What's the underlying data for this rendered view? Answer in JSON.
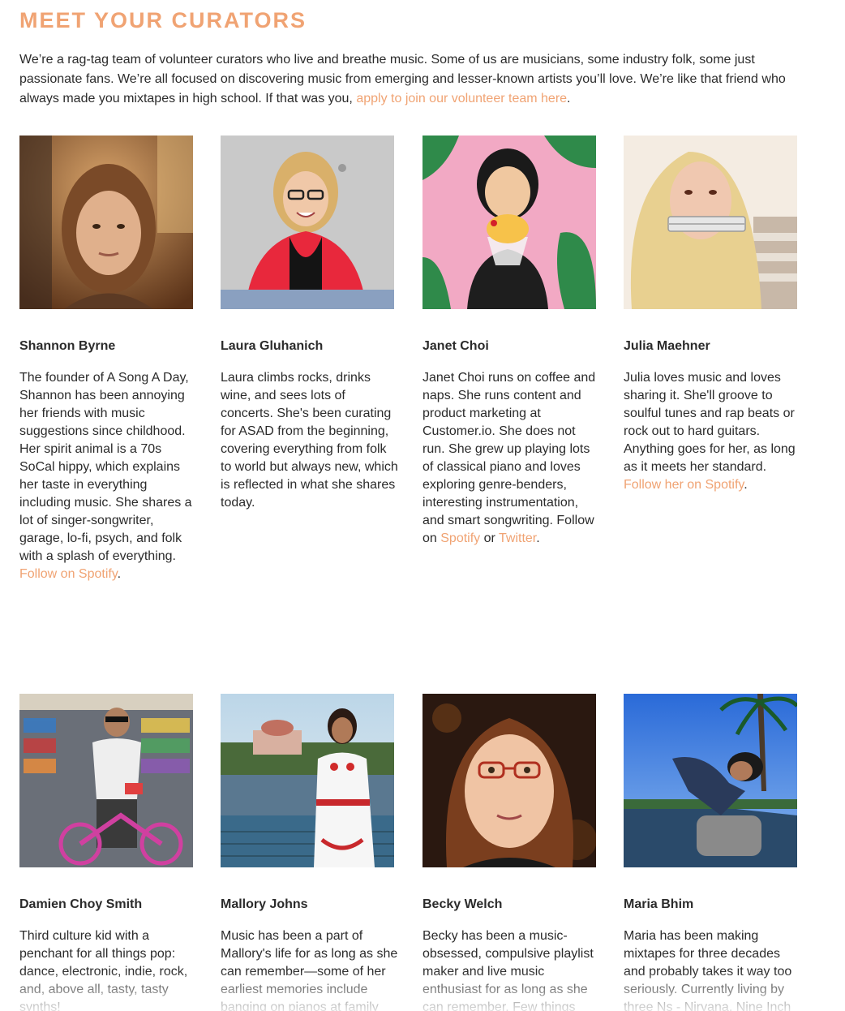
{
  "heading": "MEET YOUR CURATORS",
  "intro": {
    "text": "We’re a rag-tag team of volunteer curators who live and breathe music. Some of us are musicians, some industry folk, some just passionate fans. We’re all focused on discovering music from emerging and lesser-known artists you’ll love. We’re like that friend who always made you mixtapes in high school. If that was you, ",
    "link": "apply to join our volunteer team here",
    "tail": "."
  },
  "colors": {
    "accent": "#f0a373",
    "text": "#2b2b2b",
    "background": "#ffffff"
  },
  "curators": [
    {
      "name": "Shannon Byrne",
      "bio": "The founder of A Song A Day, Shannon has been annoying her friends with music suggestions since childhood. Her spirit animal is a 70s SoCal hippy, which explains her taste in everything including music. She shares a lot of singer-songwriter, garage, lo-fi, psych, and folk with a splash of everything. ",
      "link1": "Follow on Spotify",
      "tail": "."
    },
    {
      "name": "Laura Gluhanich",
      "bio": "Laura climbs rocks, drinks wine, and sees lots of concerts. She's been curating for ASAD from the beginning, covering everything from folk to world but always new, which is reflected in what she shares today."
    },
    {
      "name": "Janet Choi",
      "bio": "Janet Choi runs on coffee and naps. She runs content and product marketing at Customer.io. She does not run. She grew up playing lots of classical piano and loves exploring genre-benders, interesting instrumentation, and smart songwriting. Follow on ",
      "link1": "Spotify",
      "mid": " or ",
      "link2": "Twitter",
      "tail": "."
    },
    {
      "name": "Julia Maehner",
      "bio": "Julia loves music and loves sharing it. She'll groove to soulful tunes and rap beats or rock out to hard guitars. Anything goes for her, as long as it meets her standard. ",
      "link1": "Follow her on Spotify",
      "tail": "."
    },
    {
      "name": "Damien Choy Smith",
      "bio": "Third culture kid with a penchant for all things pop: dance, electronic, indie, rock, and, above all, tasty, tasty synths!"
    },
    {
      "name": "Mallory Johns",
      "bio": "Music has been a part of Mallory's life for as long as she can remember—some of her earliest memories include banging on pianos at family"
    },
    {
      "name": "Becky Welch",
      "bio": "Becky has been a music-obsessed, compulsive playlist maker and live music enthusiast for as long as she can remember. Few things"
    },
    {
      "name": "Maria Bhim",
      "bio": "Maria has been making mixtapes for three decades and probably takes it way too seriously. Currently living by three Ns - Nirvana, Nine Inch"
    }
  ]
}
